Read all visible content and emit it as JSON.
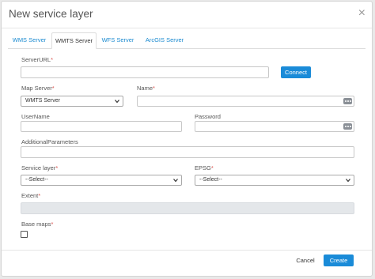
{
  "dialog": {
    "title": "New service layer",
    "close_glyph": "×"
  },
  "tabs": [
    {
      "label": "WMS Server",
      "active": false
    },
    {
      "label": "WMTS Server",
      "active": true
    },
    {
      "label": "WFS Server",
      "active": false
    },
    {
      "label": "ArcGIS Server",
      "active": false
    }
  ],
  "form": {
    "server_url": {
      "label": "ServerURL",
      "required": "*",
      "value": ""
    },
    "connect_label": "Connect",
    "map_server": {
      "label": "Map Server",
      "required": "*",
      "selected": "WMTS Server"
    },
    "name": {
      "label": "Name",
      "required": "*",
      "value": ""
    },
    "username": {
      "label": "UserName",
      "value": ""
    },
    "password": {
      "label": "Password",
      "value": ""
    },
    "additional_parameters": {
      "label": "AdditionalParameters",
      "value": ""
    },
    "service_layer": {
      "label": "Service layer",
      "required": "*",
      "selected": "--Select--"
    },
    "epsg": {
      "label": "EPSG",
      "required": "*",
      "selected": "--Select--"
    },
    "extent": {
      "label": "Extent",
      "required": "*",
      "value": ""
    },
    "base_maps": {
      "label": "Base maps",
      "required": "*",
      "checked": false
    }
  },
  "footer": {
    "cancel_label": "Cancel",
    "create_label": "Create"
  },
  "icons": [
    "close-icon",
    "chevron-down-icon",
    "password-dots-icon"
  ],
  "colors": {
    "accent": "#1a8bd8",
    "required": "#d9534f",
    "disabled_field": "#e4e7ea"
  }
}
